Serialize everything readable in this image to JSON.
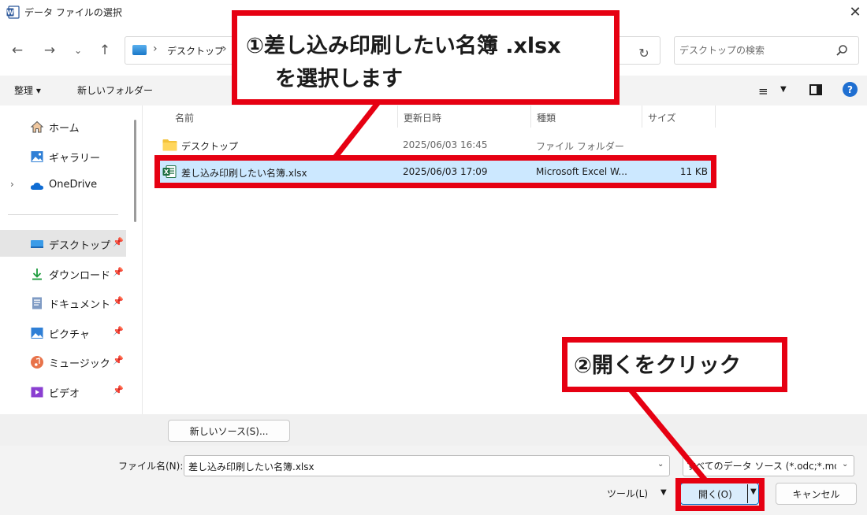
{
  "window": {
    "title": "データ ファイルの選択",
    "close_label": "✕"
  },
  "address": {
    "crumb": "デスクトップ",
    "separator": "›"
  },
  "search": {
    "placeholder": "デスクトップの検索"
  },
  "toolbar": {
    "organize": "整理 ▾",
    "new_folder": "新しいフォルダー"
  },
  "sidebar": {
    "items": [
      {
        "label": "ホーム",
        "icon": "home-icon"
      },
      {
        "label": "ギャラリー",
        "icon": "gallery-icon"
      },
      {
        "label": "OneDrive",
        "icon": "cloud-icon"
      },
      {
        "label": "デスクトップ",
        "icon": "desktop-icon",
        "pinned": true,
        "selected": true
      },
      {
        "label": "ダウンロード",
        "icon": "download-icon",
        "pinned": true
      },
      {
        "label": "ドキュメント",
        "icon": "document-icon",
        "pinned": true
      },
      {
        "label": "ピクチャ",
        "icon": "picture-icon",
        "pinned": true
      },
      {
        "label": "ミュージック",
        "icon": "music-icon",
        "pinned": true
      },
      {
        "label": "ビデオ",
        "icon": "video-icon",
        "pinned": true
      }
    ]
  },
  "columns": {
    "name": "名前",
    "modified": "更新日時",
    "type": "種類",
    "size": "サイズ"
  },
  "files": [
    {
      "name": "デスクトップ",
      "modified": "2025/06/03 16:45",
      "type": "ファイル フォルダー",
      "size": "",
      "icon": "folder-icon"
    },
    {
      "name": "差し込み印刷したい名簿.xlsx",
      "modified": "2025/06/03 17:09",
      "type": "Microsoft Excel W...",
      "size": "11 KB",
      "icon": "excel-icon",
      "selected": true
    }
  ],
  "bottom": {
    "new_source": "新しいソース(S)...",
    "filename_label": "ファイル名(N):",
    "filename_value": "差し込み印刷したい名簿.xlsx",
    "filetype_value": "すべてのデータ ソース (*.odc;*.mdb",
    "tools": "ツール(L)",
    "open": "開く(O)",
    "cancel": "キャンセル"
  },
  "annotations": {
    "callout_1_line1": "①差し込み印刷したい名簿 .xlsx",
    "callout_1_line2": "を選択します",
    "callout_2": "②開くをクリック"
  },
  "colors": {
    "accent": "#e60012",
    "selection": "#cce8ff",
    "primary_button": "#0067c0"
  }
}
